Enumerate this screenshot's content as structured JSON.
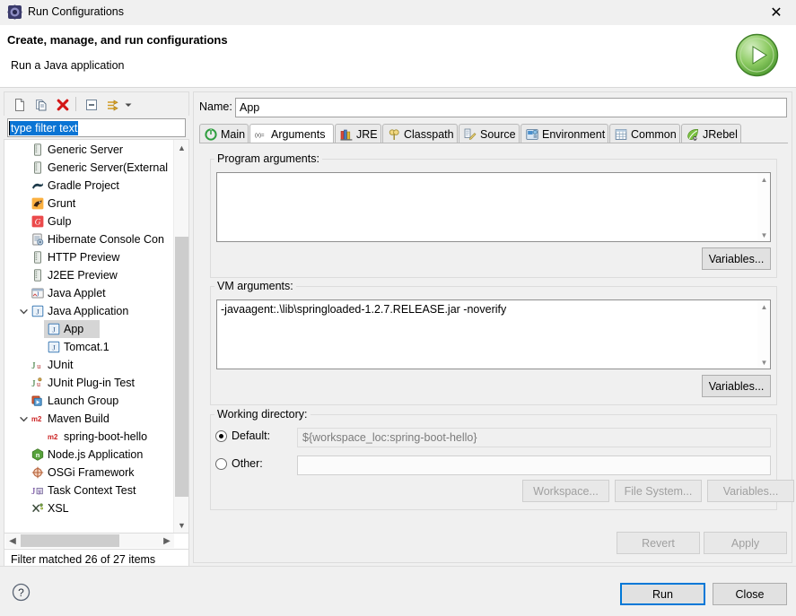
{
  "window": {
    "title": "Run Configurations",
    "icon": "run-configurations-icon",
    "close_label": "✕"
  },
  "header": {
    "title": "Create, manage, and run configurations",
    "subtitle": "Run a Java application",
    "run_icon": "green-run-play-icon"
  },
  "left_panel": {
    "toolbar": [
      {
        "name": "new-configuration-button",
        "icon": "new-file-icon",
        "tooltip": "New launch configuration"
      },
      {
        "name": "duplicate-configuration-button",
        "icon": "copy-icon",
        "tooltip": "Duplicate currently selected launch configuration"
      },
      {
        "name": "delete-configuration-button",
        "icon": "delete-red-x-icon",
        "tooltip": "Delete selected launch configuration(s)"
      },
      {
        "name": "collapse-all-button",
        "icon": "collapse-all-icon",
        "tooltip": "Collapse All"
      },
      {
        "name": "filter-button",
        "icon": "filter-arrows-icon",
        "tooltip": "Filter launch configurations"
      },
      {
        "name": "view-menu-button",
        "icon": "chevron-down-icon",
        "tooltip": "View Menu"
      }
    ],
    "filter": {
      "value": "type filter text",
      "placeholder": "type filter text",
      "selected": true
    },
    "tree": [
      {
        "label": "Generic Server",
        "icon": "server-icon",
        "level": 1,
        "expander": "none",
        "selected": false
      },
      {
        "label": "Generic Server(External",
        "icon": "server-icon",
        "level": 1,
        "expander": "none",
        "selected": false
      },
      {
        "label": "Gradle Project",
        "icon": "gradle-icon",
        "level": 1,
        "expander": "none",
        "selected": false
      },
      {
        "label": "Grunt",
        "icon": "grunt-icon",
        "level": 1,
        "expander": "none",
        "selected": false
      },
      {
        "label": "Gulp",
        "icon": "gulp-icon",
        "level": 1,
        "expander": "none",
        "selected": false
      },
      {
        "label": "Hibernate Console Con",
        "icon": "hibernate-icon",
        "level": 1,
        "expander": "none",
        "selected": false
      },
      {
        "label": "HTTP Preview",
        "icon": "server-icon",
        "level": 1,
        "expander": "none",
        "selected": false
      },
      {
        "label": "J2EE Preview",
        "icon": "server-icon",
        "level": 1,
        "expander": "none",
        "selected": false
      },
      {
        "label": "Java Applet",
        "icon": "java-applet-icon",
        "level": 1,
        "expander": "none",
        "selected": false
      },
      {
        "label": "Java Application",
        "icon": "java-app-icon",
        "level": 1,
        "expander": "expanded",
        "selected": false
      },
      {
        "label": "App",
        "icon": "java-app-icon",
        "level": 2,
        "expander": "none",
        "selected": true
      },
      {
        "label": "Tomcat.1",
        "icon": "java-app-icon",
        "level": 2,
        "expander": "none",
        "selected": false
      },
      {
        "label": "JUnit",
        "icon": "junit-icon",
        "level": 1,
        "expander": "none",
        "selected": false
      },
      {
        "label": "JUnit Plug-in Test",
        "icon": "junit-plugin-icon",
        "level": 1,
        "expander": "none",
        "selected": false
      },
      {
        "label": "Launch Group",
        "icon": "launch-group-icon",
        "level": 1,
        "expander": "none",
        "selected": false
      },
      {
        "label": "Maven Build",
        "icon": "maven-icon",
        "level": 1,
        "expander": "expanded",
        "selected": false
      },
      {
        "label": "spring-boot-hello",
        "icon": "maven-icon",
        "level": 2,
        "expander": "none",
        "selected": false
      },
      {
        "label": "Node.js Application",
        "icon": "nodejs-icon",
        "level": 1,
        "expander": "none",
        "selected": false
      },
      {
        "label": "OSGi Framework",
        "icon": "osgi-icon",
        "level": 1,
        "expander": "none",
        "selected": false
      },
      {
        "label": "Task Context Test",
        "icon": "task-context-icon",
        "level": 1,
        "expander": "none",
        "selected": false
      },
      {
        "label": "XSL",
        "icon": "xsl-icon",
        "level": 1,
        "expander": "none",
        "selected": false
      }
    ],
    "status": "Filter matched 26 of 27 items"
  },
  "right_panel": {
    "name_label": "Name:",
    "name_value": "App",
    "tabs": [
      {
        "label": "Main",
        "icon": "main-green-circle-icon",
        "active": false
      },
      {
        "label": "Arguments",
        "icon": "arguments-xequals-icon",
        "active": true
      },
      {
        "label": "JRE",
        "icon": "jre-books-icon",
        "active": false
      },
      {
        "label": "Classpath",
        "icon": "classpath-pin-icon",
        "active": false
      },
      {
        "label": "Source",
        "icon": "source-pencil-icon",
        "active": false
      },
      {
        "label": "Environment",
        "icon": "environment-icon",
        "active": false
      },
      {
        "label": "Common",
        "icon": "common-table-icon",
        "active": false
      },
      {
        "label": "JRebel",
        "icon": "jrebel-leaf-icon",
        "active": false
      }
    ],
    "program_arguments": {
      "label": "Program arguments:",
      "value": "",
      "variables_button": "Variables..."
    },
    "vm_arguments": {
      "label": "VM arguments:",
      "value": "-javaagent:.\\lib\\springloaded-1.2.7.RELEASE.jar -noverify",
      "variables_button": "Variables..."
    },
    "working_directory": {
      "label": "Working directory:",
      "default_radio": "Default:",
      "default_selected": true,
      "default_value": "${workspace_loc:spring-boot-hello}",
      "other_radio": "Other:",
      "other_selected": false,
      "other_value": "",
      "workspace_button": "Workspace...",
      "filesystem_button": "File System...",
      "variables_button": "Variables..."
    },
    "revert_button": "Revert",
    "apply_button": "Apply"
  },
  "footer": {
    "help_icon": "help-question-icon",
    "run_button": "Run",
    "close_button": "Close"
  },
  "colors": {
    "accent": "#0078d7",
    "selection": "#0a74d4",
    "window_bg": "#f0f0f0",
    "panel_bg": "#ffffff",
    "run_green": "#6fbf4a"
  }
}
